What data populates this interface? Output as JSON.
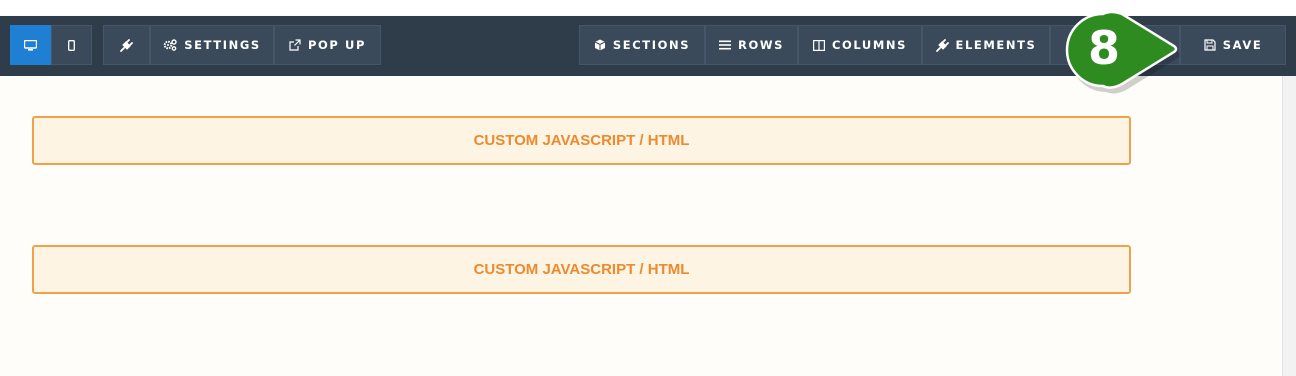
{
  "toolbar": {
    "left": [
      {
        "id": "desktop",
        "label": "",
        "icon": "desktop-icon",
        "active": true
      },
      {
        "id": "mobile",
        "label": "",
        "icon": "mobile-icon",
        "active": false
      },
      {
        "id": "plugin",
        "label": "",
        "icon": "plug-icon",
        "active": false
      },
      {
        "id": "settings",
        "label": "SETTINGS",
        "icon": "gears-icon"
      },
      {
        "id": "popup",
        "label": "POP UP",
        "icon": "external-link-icon"
      }
    ],
    "right": [
      {
        "id": "sections",
        "label": "SECTIONS",
        "icon": "cube-icon"
      },
      {
        "id": "rows",
        "label": "ROWS",
        "icon": "bars-icon"
      },
      {
        "id": "columns",
        "label": "COLUMNS",
        "icon": "columns-icon"
      },
      {
        "id": "elements",
        "label": "ELEMENTS",
        "icon": "plug-icon"
      },
      {
        "id": "save",
        "label": "SAVE",
        "icon": "floppy-icon"
      }
    ],
    "accent_color": "#1e7fd3",
    "bg_color": "#2f3d4b"
  },
  "blocks": [
    {
      "label": "CUSTOM JAVASCRIPT / HTML"
    },
    {
      "label": "CUSTOM JAVASCRIPT / HTML"
    }
  ],
  "callout": {
    "number": "8",
    "color": "#2e8b1f"
  }
}
